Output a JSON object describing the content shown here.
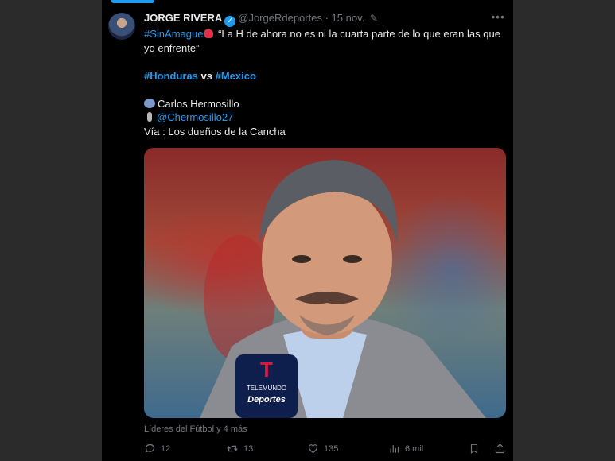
{
  "author": {
    "name": "JORGE RIVERA",
    "handle": "@JorgeRdeportes",
    "separator": "·",
    "date": "15 nov."
  },
  "tweet": {
    "line1_hashtag": "#SinAmague",
    "line1_quote": "“La H de ahora no es ni la cuarta parte de lo que eran las que yo enfrente”",
    "line2_hashtag1": "#Honduras",
    "line2_vs": " vs ",
    "line2_hashtag2": "#Mexico",
    "speaker": "Carlos Hermosillo",
    "mention": "@Chermosillo27",
    "via": "Vía : Los dueños de la Cancha"
  },
  "photo": {
    "badge_brand": "TELEMUNDO",
    "badge_sub": "Deportes"
  },
  "photo_credit": "Líderes del Fútbol y 4 más",
  "actions": {
    "replies": "12",
    "retweets": "13",
    "likes": "135",
    "views": "6 mil"
  },
  "icons": [
    "verified-icon",
    "edit-icon",
    "more-icon",
    "reply-icon",
    "retweet-icon",
    "like-icon",
    "views-icon",
    "bookmark-icon",
    "share-icon"
  ],
  "colors": {
    "accent": "#1d9bf0",
    "background": "#000000",
    "muted": "#71767b",
    "text": "#e7e9ea"
  }
}
